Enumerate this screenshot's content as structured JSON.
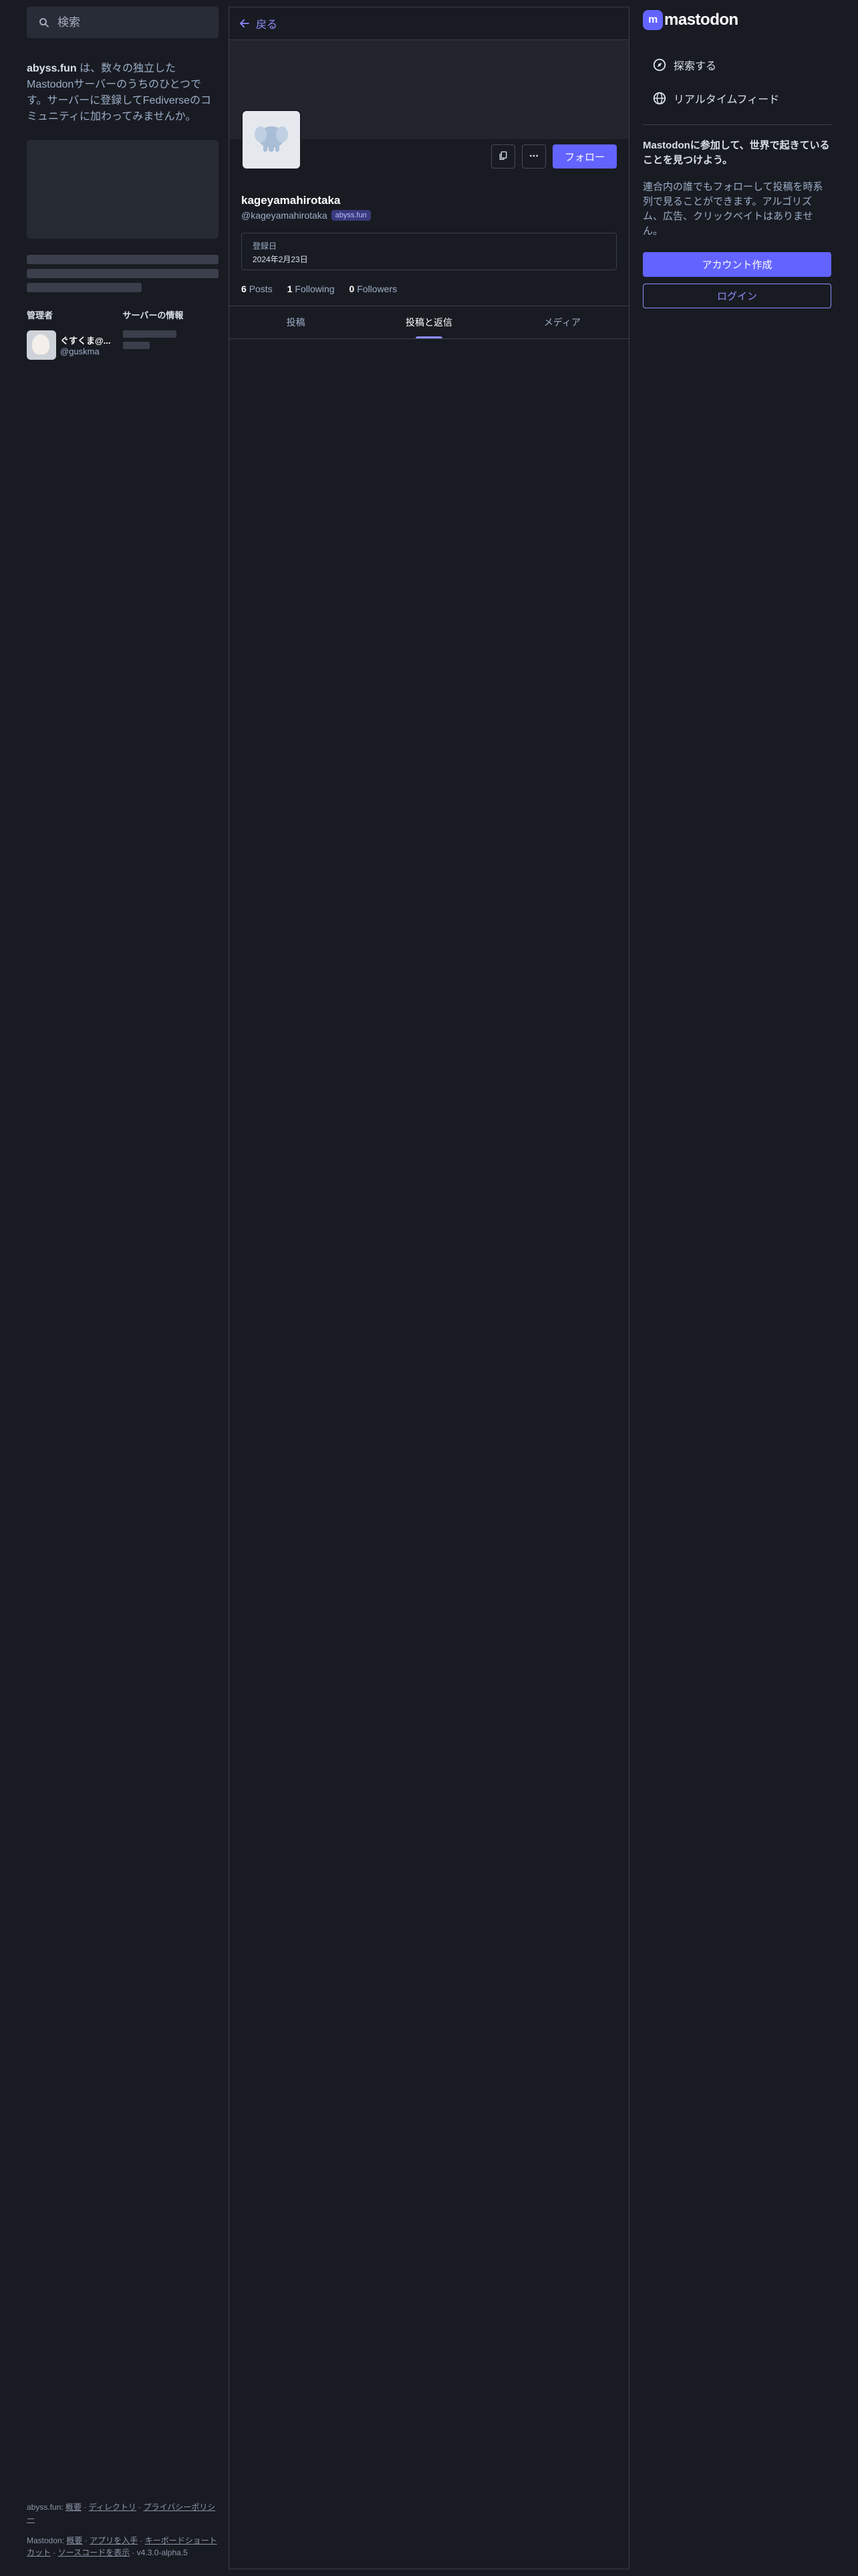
{
  "search": {
    "placeholder": "検索"
  },
  "server": {
    "domain": "abyss.fun",
    "description": " は、数々の独立したMastodonサーバーのうちのひとつです。サーバーに登録してFediverseのコミュニティに加わってみませんか。",
    "admin_label": "管理者",
    "info_label": "サーバーの情報",
    "admin_name": "ぐすくま@...",
    "admin_handle": "@guskma"
  },
  "footer": {
    "server_name": "abyss.fun",
    "sep": ": ",
    "links1": [
      "概要",
      "ディレクトリ",
      "プライバシーポリシー"
    ],
    "mastodon_name": "Mastodon",
    "links2": [
      "概要",
      "アプリを入手",
      "キーボードショートカット",
      "ソースコードを表示"
    ],
    "version": "v4.3.0-alpha.5"
  },
  "column": {
    "back_label": "戻る"
  },
  "profile": {
    "display_name": "kageyamahirotaka",
    "handle": "@kageyamahirotaka",
    "domain_badge": "abyss.fun",
    "follow_label": "フォロー",
    "joined_label": "登録日",
    "joined_value": "2024年2月23日",
    "posts_count": "6",
    "posts_label": "Posts",
    "following_count": "1",
    "following_label": "Following",
    "followers_count": "0",
    "followers_label": "Followers"
  },
  "tabs": [
    {
      "label": "投稿"
    },
    {
      "label": "投稿と返信",
      "active": true
    },
    {
      "label": "メディア"
    }
  ],
  "sidebar_right": {
    "logo_text": "mastodon",
    "nav": [
      {
        "label": "探索する",
        "icon": "explore-icon"
      },
      {
        "label": "リアルタイムフィード",
        "icon": "globe-icon"
      }
    ],
    "signup_strong": "Mastodonに参加して、世界で起きていることを見つけよう。",
    "signup_text": "連合内の誰でもフォローして投稿を時系列で見ることができます。アルゴリズム、広告、クリックベイトはありません。",
    "create_account": "アカウント作成",
    "login": "ログイン"
  },
  "colors": {
    "accent": "#6364ff",
    "link": "#8c8dff",
    "bg": "#191b22"
  }
}
